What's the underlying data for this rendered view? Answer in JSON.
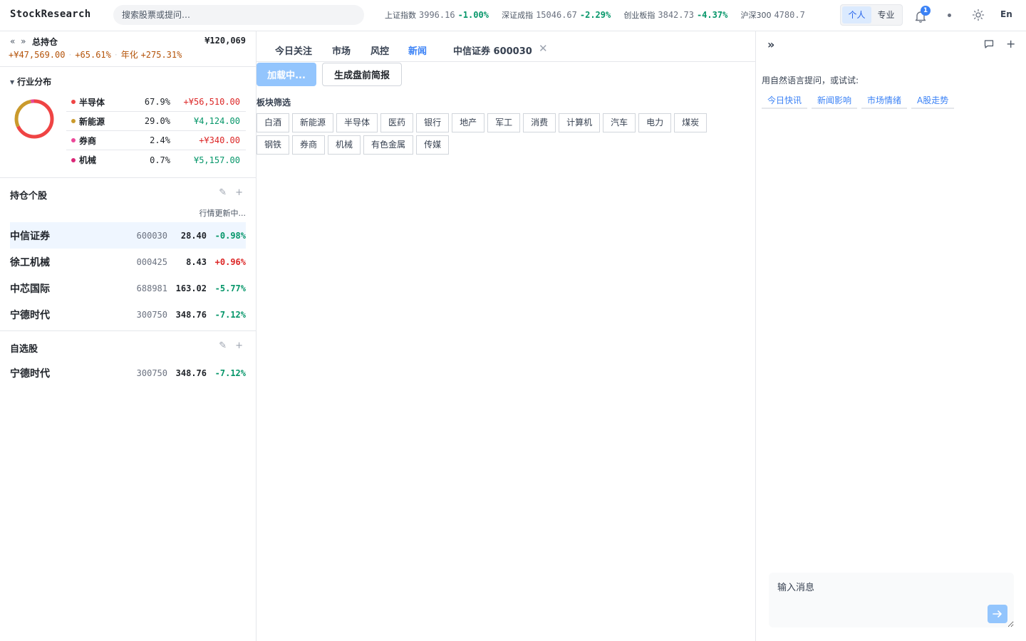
{
  "app": {
    "logo": "StockResearch"
  },
  "search": {
    "placeholder": "搜索股票或提问…"
  },
  "indices": [
    {
      "name": "上证指数",
      "value": "3996.16",
      "change": "-1.00%"
    },
    {
      "name": "深证成指",
      "value": "15046.67",
      "change": "-2.29%"
    },
    {
      "name": "创业板指",
      "value": "3842.73",
      "change": "-4.37%"
    },
    {
      "name": "沪深300",
      "value": "4780.7",
      "change": ""
    }
  ],
  "mode": {
    "personal": "个人",
    "pro": "专业"
  },
  "notifications": {
    "count": "1"
  },
  "lang": "En",
  "portfolio": {
    "arrows": "« »",
    "title": "总持仓",
    "total": "¥120,069",
    "pnl": "+¥47,569.00",
    "pnl_pct": "+65.61%",
    "annual_label": "年化",
    "annual_pct": "+275.31%"
  },
  "industry": {
    "title": "行业分布",
    "rows": [
      {
        "name": "半导体",
        "pct": "67.9%",
        "amount": "+¥56,510.00",
        "dir": "up",
        "color": "#ef4444",
        "share": 0.679
      },
      {
        "name": "新能源",
        "pct": "29.0%",
        "amount": "¥4,124.00",
        "dir": "down",
        "color": "#ca9a2c",
        "share": 0.29
      },
      {
        "name": "券商",
        "pct": "2.4%",
        "amount": "+¥340.00",
        "dir": "up",
        "color": "#ec4899",
        "share": 0.024
      },
      {
        "name": "机械",
        "pct": "0.7%",
        "amount": "¥5,157.00",
        "dir": "down",
        "color": "#db2777",
        "share": 0.007
      }
    ]
  },
  "holdings": {
    "title": "持仓个股",
    "status": "行情更新中...",
    "rows": [
      {
        "name": "中信证券",
        "code": "600030",
        "price": "28.40",
        "change": "-0.98%",
        "dir": "down",
        "selected": true
      },
      {
        "name": "徐工机械",
        "code": "000425",
        "price": "8.43",
        "change": "+0.96%",
        "dir": "up",
        "selected": false
      },
      {
        "name": "中芯国际",
        "code": "688981",
        "price": "163.02",
        "change": "-5.77%",
        "dir": "down",
        "selected": false
      },
      {
        "name": "宁德时代",
        "code": "300750",
        "price": "348.76",
        "change": "-7.12%",
        "dir": "down",
        "selected": false
      }
    ]
  },
  "watchlist": {
    "title": "自选股",
    "rows": [
      {
        "name": "宁德时代",
        "code": "300750",
        "price": "348.76",
        "change": "-7.12%",
        "dir": "down"
      }
    ]
  },
  "tabs": {
    "today": "今日关注",
    "market": "市场",
    "risk": "风控",
    "news": "新闻",
    "stock": "中信证券 600030",
    "close": "✕"
  },
  "news": {
    "loading_label": "加载中...",
    "brief_label": "生成盘前简报",
    "filter_label": "板块筛选",
    "sectors": [
      "白酒",
      "新能源",
      "半导体",
      "医药",
      "银行",
      "地产",
      "军工",
      "消费",
      "计算机",
      "汽车",
      "电力",
      "煤炭",
      "钢铁",
      "券商",
      "机械",
      "有色金属",
      "传媒"
    ]
  },
  "chat": {
    "collapse": "»",
    "hint": "用自然语言提问，或试试:",
    "suggestions": [
      "今日快讯",
      "新闻影响",
      "市场情绪",
      "A股走势"
    ],
    "input_placeholder": "输入消息"
  }
}
